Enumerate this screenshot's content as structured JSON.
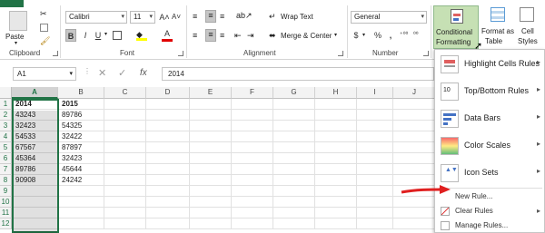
{
  "ribbon": {
    "clipboard": {
      "paste_label": "Paste",
      "group_label": "Clipboard"
    },
    "font": {
      "font_name": "Calibri",
      "font_size": "11",
      "group_label": "Font",
      "bold": "B",
      "italic": "I",
      "underline": "U",
      "grow": "A˄",
      "shrink": "A˅",
      "font_color": "A"
    },
    "alignment": {
      "wrap_text": "Wrap Text",
      "merge_center": "Merge & Center",
      "group_label": "Alignment"
    },
    "number": {
      "format": "General",
      "currency": "$",
      "percent": "%",
      "comma": ",",
      "group_label": "Number"
    },
    "styles": {
      "conditional_formatting_1": "Conditional",
      "conditional_formatting_2": "Formatting",
      "format_table_1": "Format as",
      "format_table_2": "Table",
      "cell_styles_1": "Cell",
      "cell_styles_2": "Styles"
    }
  },
  "formula_bar": {
    "name_box": "A1",
    "cancel": "✕",
    "enter": "✓",
    "fx": "fx",
    "value": "2014"
  },
  "grid": {
    "columns": [
      "A",
      "B",
      "C",
      "D",
      "E",
      "F",
      "G",
      "H",
      "I",
      "J"
    ],
    "rows": [
      "1",
      "2",
      "3",
      "4",
      "5",
      "6",
      "7",
      "8",
      "9",
      "10",
      "11",
      "12"
    ],
    "colA": [
      "2014",
      "43243",
      "32423",
      "54533",
      "67567",
      "45364",
      "89786",
      "90908"
    ],
    "colB": [
      "2015",
      "89786",
      "54325",
      "32422",
      "87897",
      "32423",
      "45644",
      "24242"
    ]
  },
  "cf_menu": {
    "highlight": "Highlight Cells Rules",
    "topbottom": "Top/Bottom Rules",
    "databars": "Data Bars",
    "colorscales": "Color Scales",
    "iconsets": "Icon Sets",
    "newrule": "New Rule...",
    "clearrules": "Clear Rules",
    "managerules": "Manage Rules..."
  },
  "colors": {
    "accent": "#217346",
    "arrow": "#e02020"
  }
}
